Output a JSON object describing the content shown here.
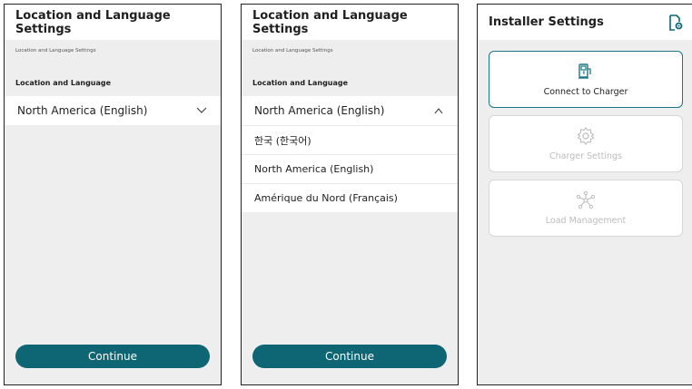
{
  "screen1": {
    "title": "Location and Language Settings",
    "subtitle": "Location and Language Settings",
    "section_label": "Location and Language",
    "selected_value": "North America (English)",
    "continue_label": "Continue"
  },
  "screen2": {
    "title": "Location and Language Settings",
    "subtitle": "Location and Language Settings",
    "section_label": "Location and Language",
    "selected_value": "North America (English)",
    "options": [
      "한국 (한국어)",
      "North America (English)",
      "Amérique du Nord (Français)"
    ],
    "continue_label": "Continue"
  },
  "screen3": {
    "title": "Installer Settings",
    "cards": [
      {
        "label": "Connect to Charger",
        "icon": "charger-icon",
        "enabled": true
      },
      {
        "label": "Charger Settings",
        "icon": "gear-icon",
        "enabled": false
      },
      {
        "label": "Load Management",
        "icon": "network-icon",
        "enabled": false
      }
    ]
  },
  "colors": {
    "accent": "#0e6573",
    "card_border_active": "#1c7685",
    "disabled_text": "#bcbcbc",
    "background": "#eeeeee"
  }
}
